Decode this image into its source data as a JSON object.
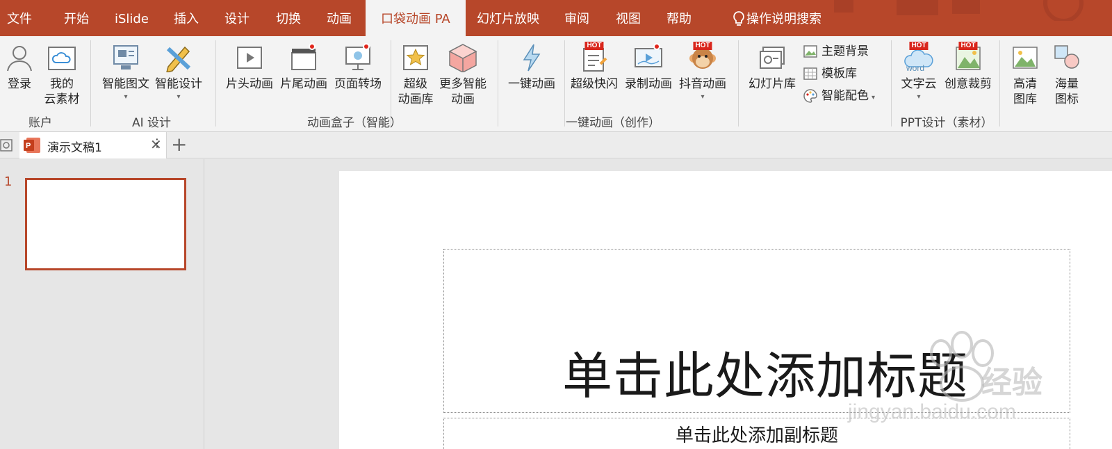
{
  "menubar": {
    "tabs": [
      {
        "label": "文件"
      },
      {
        "label": "开始"
      },
      {
        "label": "iSlide"
      },
      {
        "label": "插入"
      },
      {
        "label": "设计"
      },
      {
        "label": "切换"
      },
      {
        "label": "动画"
      },
      {
        "label": "口袋动画 PA"
      },
      {
        "label": "幻灯片放映"
      },
      {
        "label": "审阅"
      },
      {
        "label": "视图"
      },
      {
        "label": "帮助"
      }
    ],
    "search_label": "操作说明搜索"
  },
  "ribbon": {
    "account": {
      "login": "登录",
      "cloud": "我的\n云素材",
      "group": "账户"
    },
    "ai": {
      "smart_graphic": "智能图文",
      "smart_design": "智能设计",
      "group": "AI 设计"
    },
    "anim_box": {
      "intro": "片头动画",
      "outro": "片尾动画",
      "transition": "页面转场",
      "super_lib_1": "超级",
      "super_lib_2": "动画库",
      "more_1": "更多智能",
      "more_2": "动画",
      "group": "动画盒子（智能）"
    },
    "one_click": {
      "one_anim": "一键动画",
      "flash": "超级快闪",
      "record": "录制动画",
      "tiktok": "抖音动画",
      "group": "一键动画（创作）"
    },
    "ppt_design": {
      "slide_lib": "幻灯片库",
      "theme_bg": "主题背景",
      "template_lib": "模板库",
      "smart_color": "智能配色",
      "word_cloud": "文字云",
      "crop": "创意裁剪",
      "hd_1": "高清",
      "hd_2": "图库",
      "icons_1": "海量",
      "icons_2": "图标",
      "group": "PPT设计（素材）"
    },
    "hot_badge": "HOT",
    "word_text": "word"
  },
  "docbar": {
    "doc_name": "演示文稿1",
    "close_glyph": "✕",
    "more_glyph": "⋮",
    "add_glyph": "+"
  },
  "thumbs": {
    "slide_number": "1"
  },
  "slide": {
    "title_placeholder": "单击此处添加标题",
    "subtitle_placeholder": "单击此处添加副标题"
  },
  "watermark": {
    "brand": "经验",
    "url": "jingyan.baidu.com"
  },
  "colors": {
    "accent": "#b7472a",
    "hot": "#d9261c",
    "ribbon_bg": "#f3f3f3"
  }
}
